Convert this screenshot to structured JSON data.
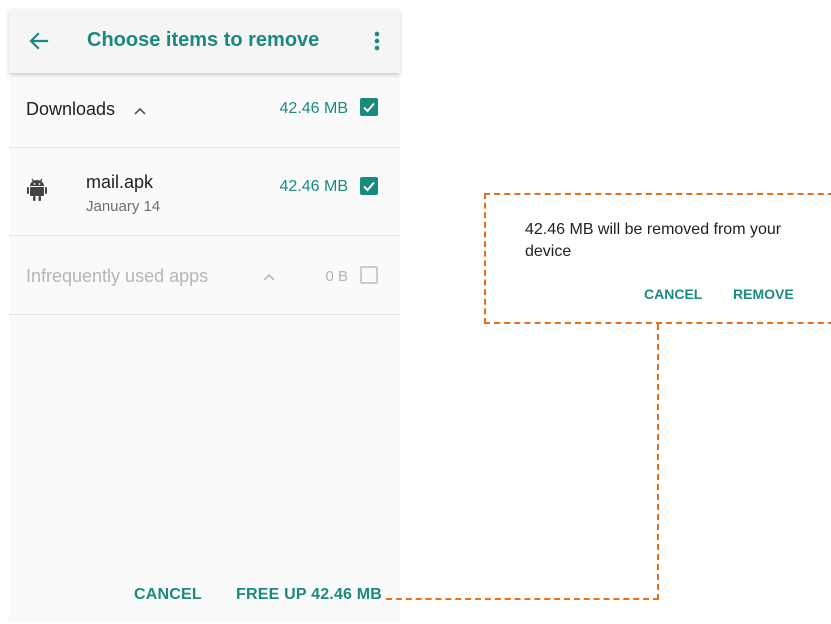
{
  "appbar": {
    "title": "Choose items to remove",
    "back_icon": "arrow-left-icon",
    "menu_icon": "more-vert-icon"
  },
  "sections": [
    {
      "title": "Downloads",
      "size": "42.46 MB",
      "checked": true,
      "expanded": true
    },
    {
      "title": "Infrequently used apps",
      "size": "0 B",
      "checked": false,
      "expanded": true
    }
  ],
  "items": [
    {
      "name": "mail.apk",
      "date": "January 14",
      "size": "42.46 MB",
      "checked": true,
      "icon": "android-icon"
    }
  ],
  "bottom_bar": {
    "cancel": "CANCEL",
    "free_up": "FREE UP 42.46 MB"
  },
  "dialog": {
    "message": "42.46 MB will be removed from your device",
    "cancel": "CANCEL",
    "remove": "REMOVE"
  },
  "colors": {
    "accent": "#1a8a7d",
    "callout": "#e8701a",
    "muted": "#b5b5b5"
  }
}
